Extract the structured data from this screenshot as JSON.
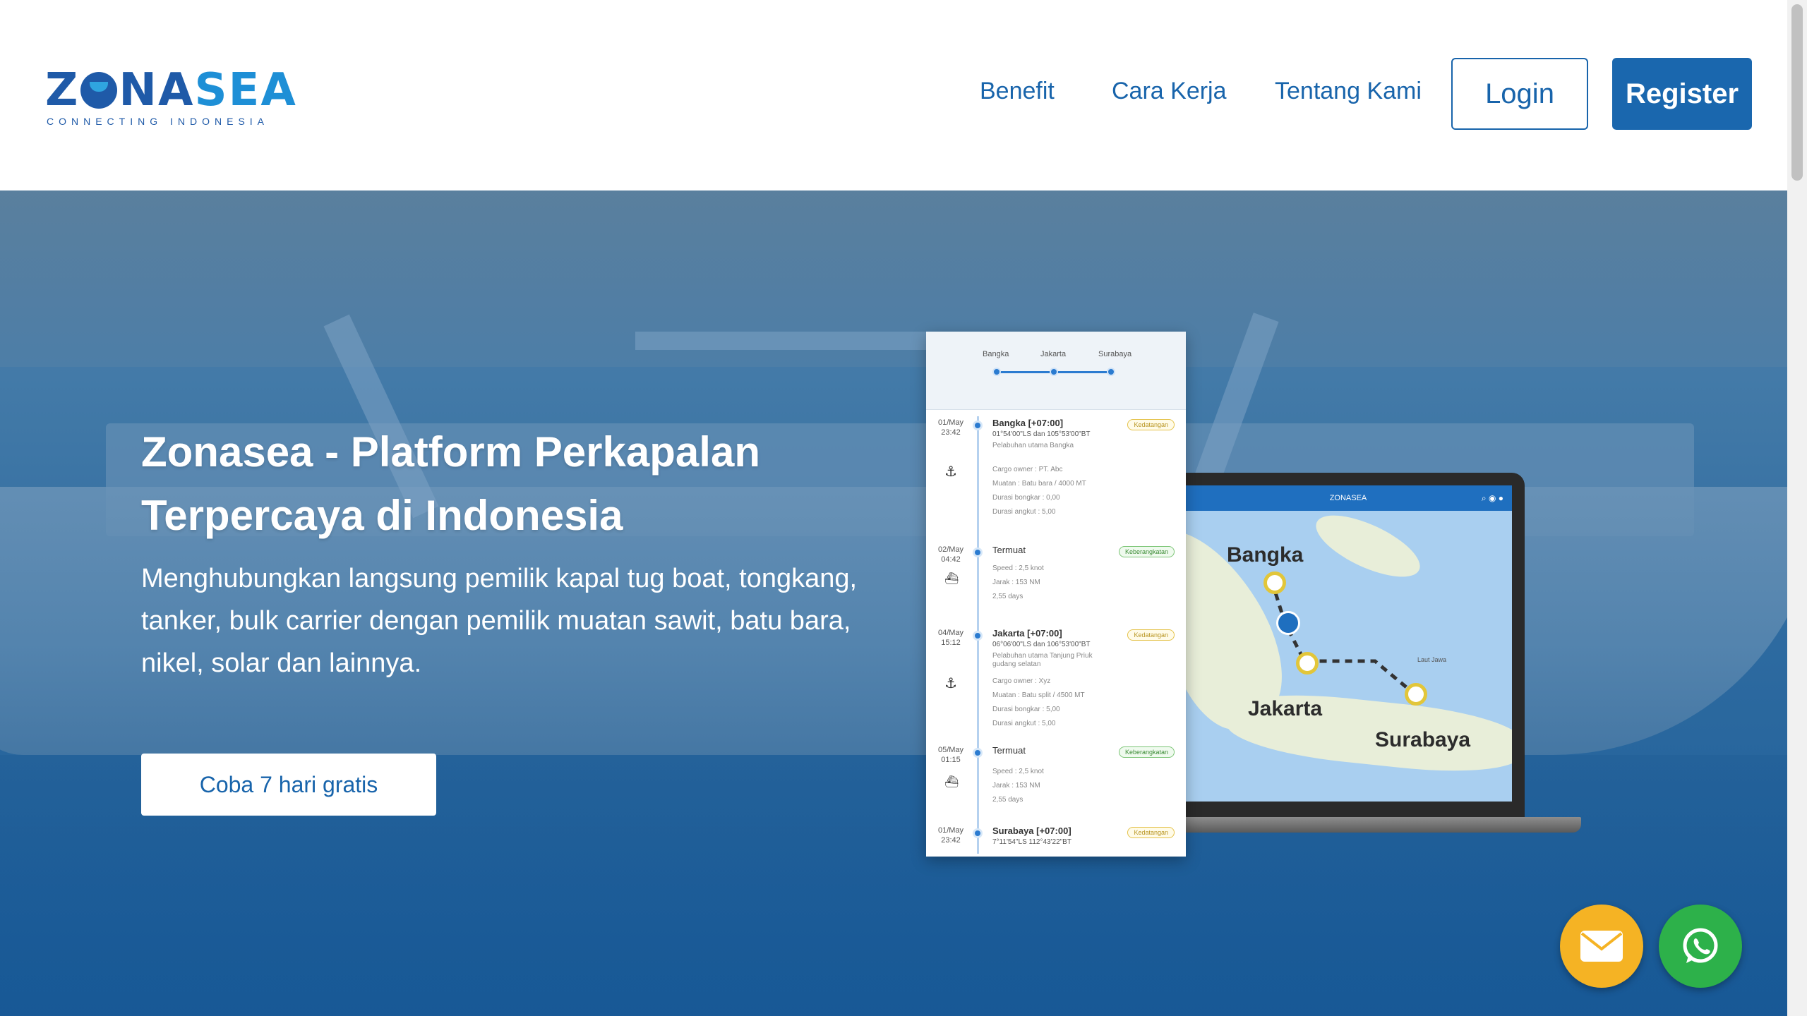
{
  "brand": {
    "name_part1": "ZONA",
    "name_part2": "SEA",
    "tagline": "CONNECTING INDONESIA"
  },
  "nav": {
    "items": [
      "Benefit",
      "Cara Kerja",
      "Tentang Kami"
    ],
    "login": "Login",
    "register": "Register"
  },
  "hero": {
    "title_line1": "Zonasea - Platform Perkapalan",
    "title_line2": "Terpercaya di Indonesia",
    "subtitle": "Menghubungkan langsung pemilik kapal tug boat, tongkang, tanker, bulk carrier dengan pemilik muatan sawit, batu bara, nikel, solar dan lainnya.",
    "cta": "Coba 7 hari gratis"
  },
  "phone_mockup": {
    "route": [
      "Bangka",
      "Jakarta",
      "Surabaya"
    ],
    "entries": [
      {
        "date": "01/May",
        "time": "23:42",
        "place": "Bangka [+07:00]",
        "coords": "01°54'00\"LS dan 105°53'00\"BT",
        "port": "Pelabuhan utama Bangka",
        "tag": "Kedatangan",
        "details": [
          "Cargo owner : PT. Abc",
          "Muatan : Batu bara / 4000 MT",
          "Durasi bongkar : 0,00",
          "Durasi angkut : 5,00"
        ]
      },
      {
        "date": "02/May",
        "time": "04:42",
        "place": "Termuat",
        "tag": "Keberangkatan",
        "details": [
          "Speed : 2,5 knot",
          "Jarak : 153 NM",
          "2,55 days"
        ]
      },
      {
        "date": "04/May",
        "time": "15:12",
        "place": "Jakarta [+07:00]",
        "coords": "06°06'00\"LS dan 106°53'00\"BT",
        "port": "Pelabuhan utama Tanjung Priuk gudang selatan",
        "tag": "Kedatangan",
        "details": [
          "Cargo owner : Xyz",
          "Muatan : Batu split / 4500 MT",
          "Durasi bongkar : 5,00",
          "Durasi angkut : 5,00"
        ]
      },
      {
        "date": "05/May",
        "time": "01:15",
        "place": "Termuat",
        "tag": "Keberangkatan",
        "details": [
          "Speed : 2,5 knot",
          "Jarak : 153 NM",
          "2,55 days"
        ]
      },
      {
        "date": "01/May",
        "time": "23:42",
        "place": "Surabaya [+07:00]",
        "coords": "7°11'54\"LS 112°43'22\"BT",
        "tag": "Kedatangan"
      }
    ]
  },
  "laptop_mockup": {
    "app_title": "ZONASEA",
    "cities": [
      "Bangka",
      "Jakarta",
      "Surabaya"
    ],
    "sea_label": "Laut Jawa"
  },
  "floating": {
    "mail_icon": "mail-icon",
    "whatsapp_icon": "whatsapp-icon"
  }
}
